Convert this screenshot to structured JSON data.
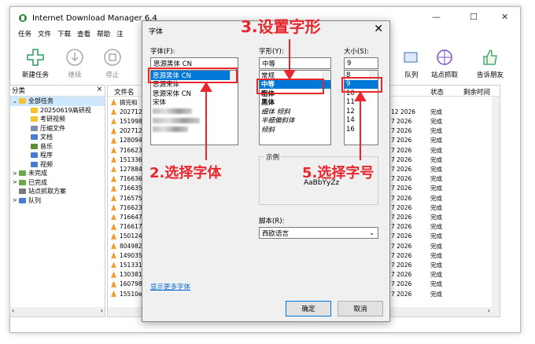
{
  "window": {
    "title": "Internet Download Manager 6.4"
  },
  "menu": [
    "任务",
    "文件",
    "下载",
    "查看",
    "帮助",
    "注"
  ],
  "toolbar": [
    {
      "label": "新建任务",
      "icon": "plus-icon"
    },
    {
      "label": "继续",
      "icon": "download-icon"
    },
    {
      "label": "停止",
      "icon": "stop-icon"
    },
    {
      "label": "队列",
      "icon": "queue-icon"
    },
    {
      "label": "站点抓取",
      "icon": "grabber-icon"
    },
    {
      "label": "告诉朋友",
      "icon": "thumbs-up-icon"
    }
  ],
  "categories": {
    "header": "分类",
    "close": "×",
    "items": [
      {
        "label": "全部任务",
        "indent": 0,
        "exp": "⌄"
      },
      {
        "label": "2025061​9高研视",
        "indent": 1
      },
      {
        "label": "考研视频",
        "indent": 1
      },
      {
        "label": "压缩文件",
        "indent": 1
      },
      {
        "label": "文档",
        "indent": 1
      },
      {
        "label": "音乐",
        "indent": 1
      },
      {
        "label": "程序",
        "indent": 1
      },
      {
        "label": "视频",
        "indent": 1
      },
      {
        "label": "未完成",
        "indent": 0,
        "exp": ">"
      },
      {
        "label": "已完成",
        "indent": 0,
        "exp": ">"
      },
      {
        "label": "站点抓取方案",
        "indent": 0
      },
      {
        "label": "队列",
        "indent": 0,
        "exp": ">"
      }
    ]
  },
  "files": {
    "col_name": "文件名",
    "col_status": "状态",
    "col_remaining": "剩余时间",
    "rows": [
      {
        "name": "搞完和",
        "date": "",
        "status": ""
      },
      {
        "name": "202712",
        "date": "12 2026",
        "status": "完成"
      },
      {
        "name": "151998",
        "date": "7 2026",
        "status": "完成"
      },
      {
        "name": "202712",
        "date": "7 2026",
        "status": "完成"
      },
      {
        "name": "128094",
        "date": "7 2026",
        "status": "完成"
      },
      {
        "name": "716623",
        "date": "7 2026",
        "status": "完成"
      },
      {
        "name": "151336",
        "date": "7 2026",
        "status": "完成"
      },
      {
        "name": "127884",
        "date": "7 2026",
        "status": "完成"
      },
      {
        "name": "716636",
        "date": "7 2026",
        "status": "完成"
      },
      {
        "name": "716635",
        "date": "7 2026",
        "status": "完成"
      },
      {
        "name": "716575",
        "date": "7 2026",
        "status": "完成"
      },
      {
        "name": "716623",
        "date": "7 2026",
        "status": "完成"
      },
      {
        "name": "716647",
        "date": "7 2026",
        "status": "完成"
      },
      {
        "name": "716617",
        "date": "7 2026",
        "status": "完成"
      },
      {
        "name": "150124",
        "date": "7 2026",
        "status": "完成"
      },
      {
        "name": "804982",
        "date": "7 2026",
        "status": "完成"
      },
      {
        "name": "149035",
        "date": "7 2026",
        "status": "完成"
      },
      {
        "name": "151331",
        "date": "7 2026",
        "status": "完成"
      },
      {
        "name": "130381",
        "date": "7 2026",
        "status": "完成"
      },
      {
        "name": "160798",
        "date": "7 2026",
        "status": "完成"
      },
      {
        "name": "15510e",
        "date": "7 2026",
        "status": "完成"
      }
    ]
  },
  "dialog": {
    "title": "字体",
    "close": "✕",
    "font_label": "字体(F):",
    "font_value": "思源黑体 CN",
    "font_list": [
      "思源黑体 CN",
      "思源宋体",
      "思源宋体 CN",
      "宋体"
    ],
    "style_label": "字形(Y):",
    "style_value": "中等",
    "style_list": [
      "常规",
      "中等",
      "粗体",
      "黑体",
      "细体 倾斜",
      "半细偏斜体",
      "倾斜"
    ],
    "size_label": "大小(S):",
    "size_value": "9",
    "size_list": [
      "8",
      "9",
      "10",
      "11",
      "12",
      "14",
      "16"
    ],
    "sample_label": "示例",
    "sample_text": "AaBbYyZz",
    "script_label": "脚本(R):",
    "script_value": "西欧语言",
    "more_fonts": "显示更多字体",
    "ok": "确定",
    "cancel": "取消"
  },
  "annotations": {
    "step2": "2.选择字体",
    "step3": "3.设置字形",
    "step5": "5.选择字号"
  }
}
